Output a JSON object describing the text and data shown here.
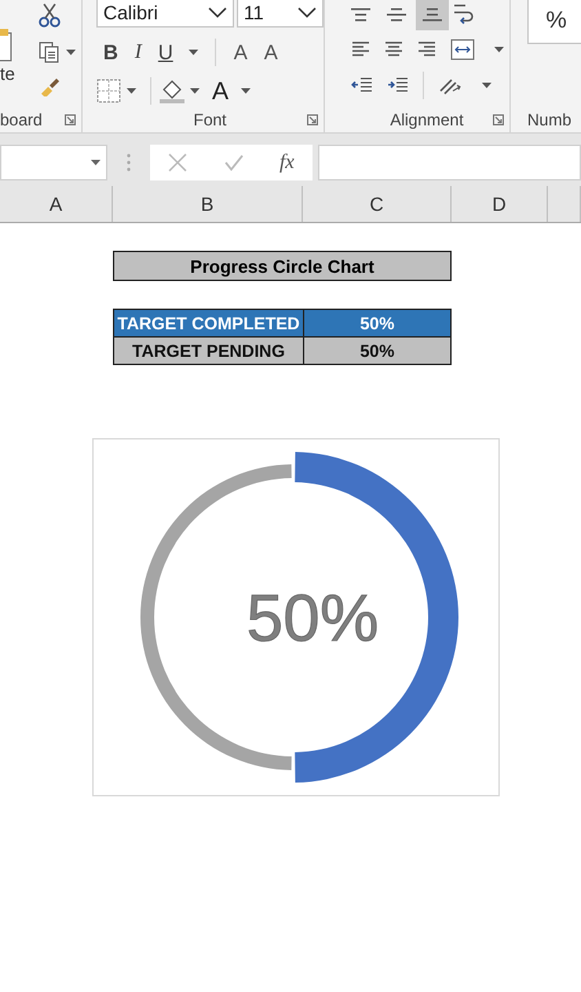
{
  "ribbon": {
    "clipboard": {
      "paste_label": "te",
      "group_label": "board"
    },
    "font": {
      "font_name": "Calibri",
      "font_size": "11",
      "bold": "B",
      "italic": "I",
      "underline": "U",
      "grow": "A",
      "shrink": "A",
      "font_color": "A",
      "group_label": "Font"
    },
    "alignment": {
      "group_label": "Alignment",
      "vertical_align": [
        {
          "kind": "top",
          "selected": false
        },
        {
          "kind": "middle",
          "selected": false
        },
        {
          "kind": "bottom",
          "selected": true
        }
      ]
    },
    "number": {
      "format_symbol": "%",
      "group_label": "Numb"
    }
  },
  "formula_bar": {
    "function_label": "fx"
  },
  "columns": [
    {
      "label": "A"
    },
    {
      "label": "B"
    },
    {
      "label": "C"
    },
    {
      "label": "D"
    }
  ],
  "sheet": {
    "title": "Progress Circle Chart",
    "rows": [
      {
        "label": "TARGET COMPLETED",
        "value": "50%",
        "color": "#2e75b6"
      },
      {
        "label": "TARGET PENDING",
        "value": "50%",
        "color": "#bfbfbf"
      }
    ]
  },
  "chart": {
    "chart_data": {
      "type": "donut",
      "values": [
        50,
        50
      ],
      "colors": [
        "#4472c4",
        "#a5a5a5"
      ],
      "annotations": [
        {
          "text": "50%"
        }
      ]
    }
  }
}
